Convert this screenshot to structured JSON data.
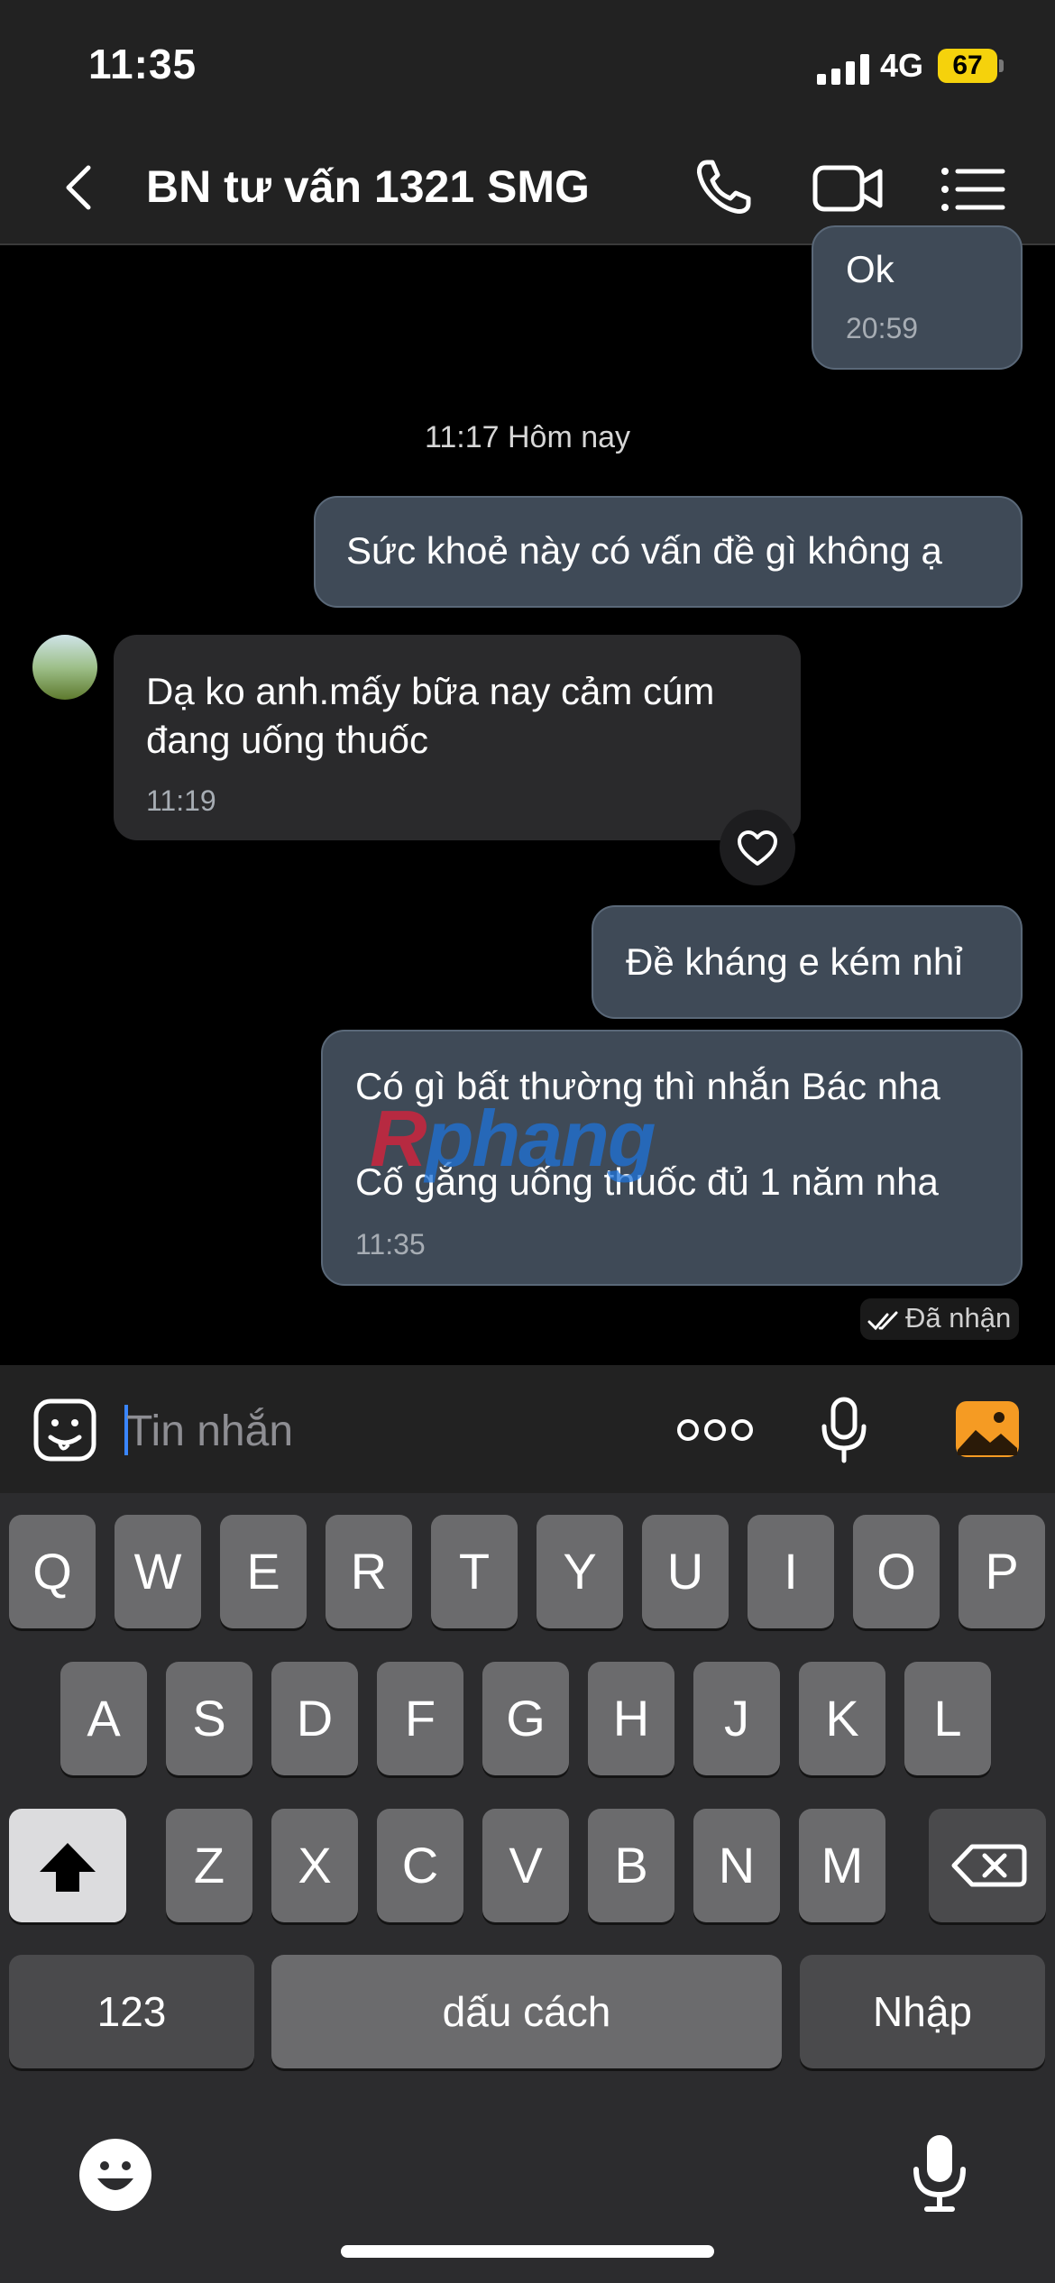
{
  "status": {
    "time": "11:35",
    "network": "4G",
    "battery": "67"
  },
  "header": {
    "title": "BN tư vấn 1321 SMG"
  },
  "chat": {
    "prev_message": {
      "text": "Ok",
      "time": "20:59"
    },
    "date_separator": "11:17 Hôm nay",
    "messages": [
      {
        "direction": "out",
        "text": "Sức khoẻ này có vấn đề gì không ạ"
      },
      {
        "direction": "in",
        "lines": [
          "Dạ ko anh.mấy bữa nay cảm cúm",
          "đang uống thuốc"
        ],
        "time": "11:19"
      },
      {
        "direction": "out",
        "text": "Đề kháng e kém nhỉ"
      },
      {
        "direction": "out",
        "lines": [
          "Có gì bất thường thì nhắn Bác nha",
          "Cố gắng uống thuốc đủ 1 năm nha"
        ],
        "time": "11:35"
      }
    ],
    "receipt": "Đã nhận",
    "watermark": {
      "part1": "R",
      "part2": "phang"
    }
  },
  "input": {
    "placeholder": "Tin nhắn"
  },
  "keyboard": {
    "row1": [
      "Q",
      "W",
      "E",
      "R",
      "T",
      "Y",
      "U",
      "I",
      "O",
      "P"
    ],
    "row2": [
      "A",
      "S",
      "D",
      "F",
      "G",
      "H",
      "J",
      "K",
      "L"
    ],
    "row3": [
      "Z",
      "X",
      "C",
      "V",
      "B",
      "N",
      "M"
    ],
    "numbers_label": "123",
    "space_label": "dấu cách",
    "return_label": "Nhập"
  },
  "icons": {
    "back": "chevron-left-icon",
    "call": "phone-icon",
    "video": "video-camera-icon",
    "menu": "list-menu-icon",
    "sticker": "sticker-icon",
    "more": "more-dots-icon",
    "mic": "microphone-icon",
    "photo": "photo-icon",
    "heart": "heart-icon",
    "shift": "shift-icon",
    "backspace": "backspace-icon",
    "emoji": "emoji-icon",
    "dictation": "dictation-mic-icon"
  },
  "colors": {
    "photo_icon": "#f59b23",
    "battery": "#f5d20c",
    "outgoing_bubble": "#3f4a57"
  }
}
